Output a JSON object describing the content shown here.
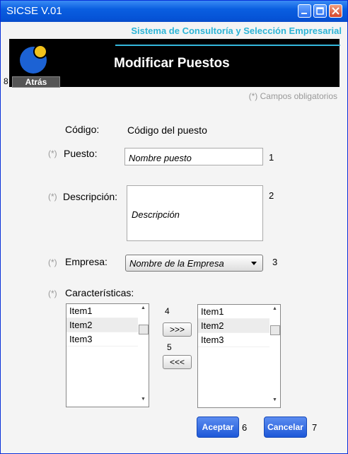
{
  "window": {
    "title": "SICSE V.01"
  },
  "header": {
    "subtitle": "Sistema de Consultoría y Selección Empresarial",
    "heading": "Modificar Puestos",
    "back_label": "Atrás"
  },
  "form": {
    "required_note": "(*) Campos obligatorios",
    "required_marker": "(*)",
    "codigo_label": "Código:",
    "codigo_value": "Código del puesto",
    "puesto_label": "Puesto:",
    "puesto_value": "Nombre puesto",
    "descripcion_label": "Descripción:",
    "descripcion_value": "Descripción",
    "empresa_label": "Empresa:",
    "empresa_value": "Nombre de la Empresa",
    "caracteristicas_label": "Características:",
    "left_list": [
      "Item1",
      "Item2",
      "Item3"
    ],
    "right_list": [
      "Item1",
      "Item2",
      "Item3"
    ],
    "add_label": ">>>",
    "remove_label": "<<<"
  },
  "actions": {
    "accept_label": "Aceptar",
    "cancel_label": "Cancelar"
  },
  "annotations": [
    "1",
    "2",
    "3",
    "4",
    "5",
    "6",
    "7",
    "8"
  ],
  "colors": {
    "accent": "#2bb4d6",
    "titlebar": "#0a5ee0",
    "logo_blue": "#1c62d4",
    "logo_yellow": "#f2c21b"
  }
}
